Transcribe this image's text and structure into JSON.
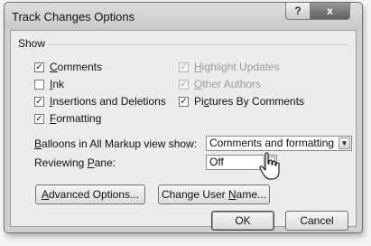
{
  "window": {
    "title": "Track Changes Options",
    "help_glyph": "?",
    "close_glyph": "x"
  },
  "show_group": {
    "label": "Show",
    "checkboxes": [
      {
        "pre": "",
        "key": "C",
        "post": "omments",
        "checked": true,
        "enabled": true
      },
      {
        "pre": "",
        "key": "I",
        "post": "nk",
        "checked": false,
        "enabled": true
      },
      {
        "pre": "",
        "key": "I",
        "post": "nsertions and Deletions",
        "checked": true,
        "enabled": true
      },
      {
        "pre": "",
        "key": "F",
        "post": "ormatting",
        "checked": true,
        "enabled": true
      },
      {
        "pre": "",
        "key": "H",
        "post": "ighlight Updates",
        "checked": true,
        "enabled": false
      },
      {
        "pre": "",
        "key": "O",
        "post": "ther Authors",
        "checked": true,
        "enabled": false
      },
      {
        "pre": "Pi",
        "key": "c",
        "post": "tures By Comments",
        "checked": true,
        "enabled": true
      }
    ],
    "check_glyph": "✓"
  },
  "balloons": {
    "label_key": "B",
    "label_rest": "alloons in All Markup view show:",
    "value": "Comments and formatting"
  },
  "reviewing_pane": {
    "label_pre": "Reviewing ",
    "label_key": "P",
    "label_rest": "ane:",
    "value": "Off"
  },
  "buttons": {
    "advanced": {
      "key": "A",
      "rest": "dvanced Options..."
    },
    "change_user": {
      "pre": "Change User ",
      "key": "N",
      "rest": "ame..."
    },
    "ok": "OK",
    "cancel": "Cancel"
  },
  "icons": {
    "combo_arrow": "▼",
    "cursor": "hand-pointer-icon"
  }
}
